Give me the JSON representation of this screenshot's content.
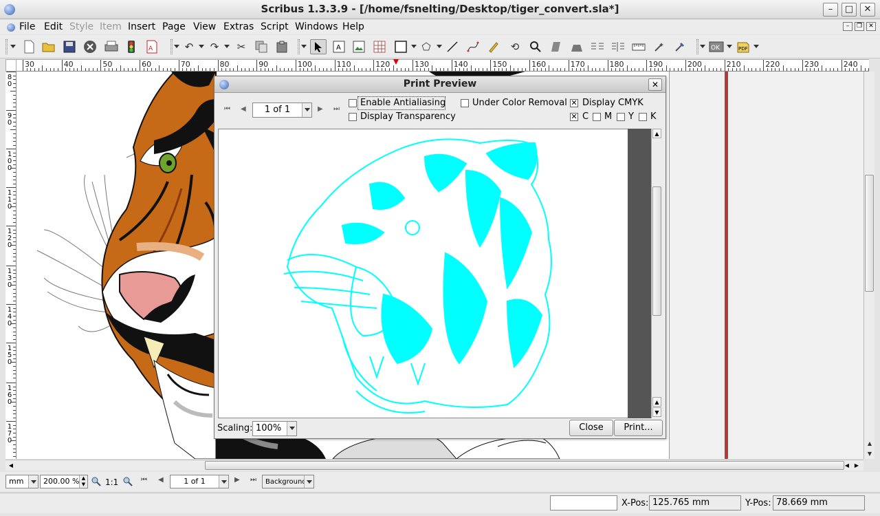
{
  "window": {
    "title": "Scribus 1.3.3.9 - [/home/fsnelting/Desktop/tiger_convert.sla*]",
    "minimize": "–",
    "maximize": "□",
    "close": "✕"
  },
  "menu": {
    "file": "File",
    "edit": "Edit",
    "style": "Style",
    "item": "Item",
    "insert": "Insert",
    "page": "Page",
    "view": "View",
    "extras": "Extras",
    "script": "Script",
    "windows": "Windows",
    "help": "Help"
  },
  "ruler": {
    "h_labels": [
      "30",
      "40",
      "50",
      "60",
      "70",
      "80",
      "90",
      "100",
      "110",
      "120",
      "130",
      "140",
      "150",
      "160",
      "170",
      "180",
      "190",
      "200",
      "210",
      "220",
      "230",
      "240"
    ],
    "v_labels": [
      "8\n0",
      "9\n0",
      "1\n0\n0",
      "1\n1\n0",
      "1\n2\n0",
      "1\n3\n0",
      "1\n4\n0",
      "1\n5\n0",
      "1\n6\n0",
      "1\n7\n0"
    ]
  },
  "bottombar": {
    "unit": "mm",
    "zoom": "200.00 %",
    "ratio": "1:1",
    "page": "1 of 1",
    "layer": "Background"
  },
  "statusbar": {
    "xpos_label": "X-Pos:",
    "xpos_value": "125.765 mm",
    "ypos_label": "Y-Pos:",
    "ypos_value": "78.669 mm"
  },
  "dialog": {
    "title": "Print Preview",
    "page_select": "1 of 1",
    "enable_antialiasing": "Enable Antialiasing",
    "display_transparency": "Display Transparency",
    "under_color_removal": "Under Color Removal",
    "display_cmyk": "Display CMYK",
    "c": "C",
    "m": "M",
    "y": "Y",
    "k": "K",
    "scaling_label": "Scaling:",
    "scaling_value": "100%",
    "close_button": "Close",
    "print_button": "Print...",
    "preview_color": "#00ffff"
  },
  "checkbox_states": {
    "enable_antialiasing": false,
    "display_transparency": false,
    "under_color_removal": false,
    "display_cmyk": true,
    "c": true,
    "m": false,
    "y": false,
    "k": false
  }
}
